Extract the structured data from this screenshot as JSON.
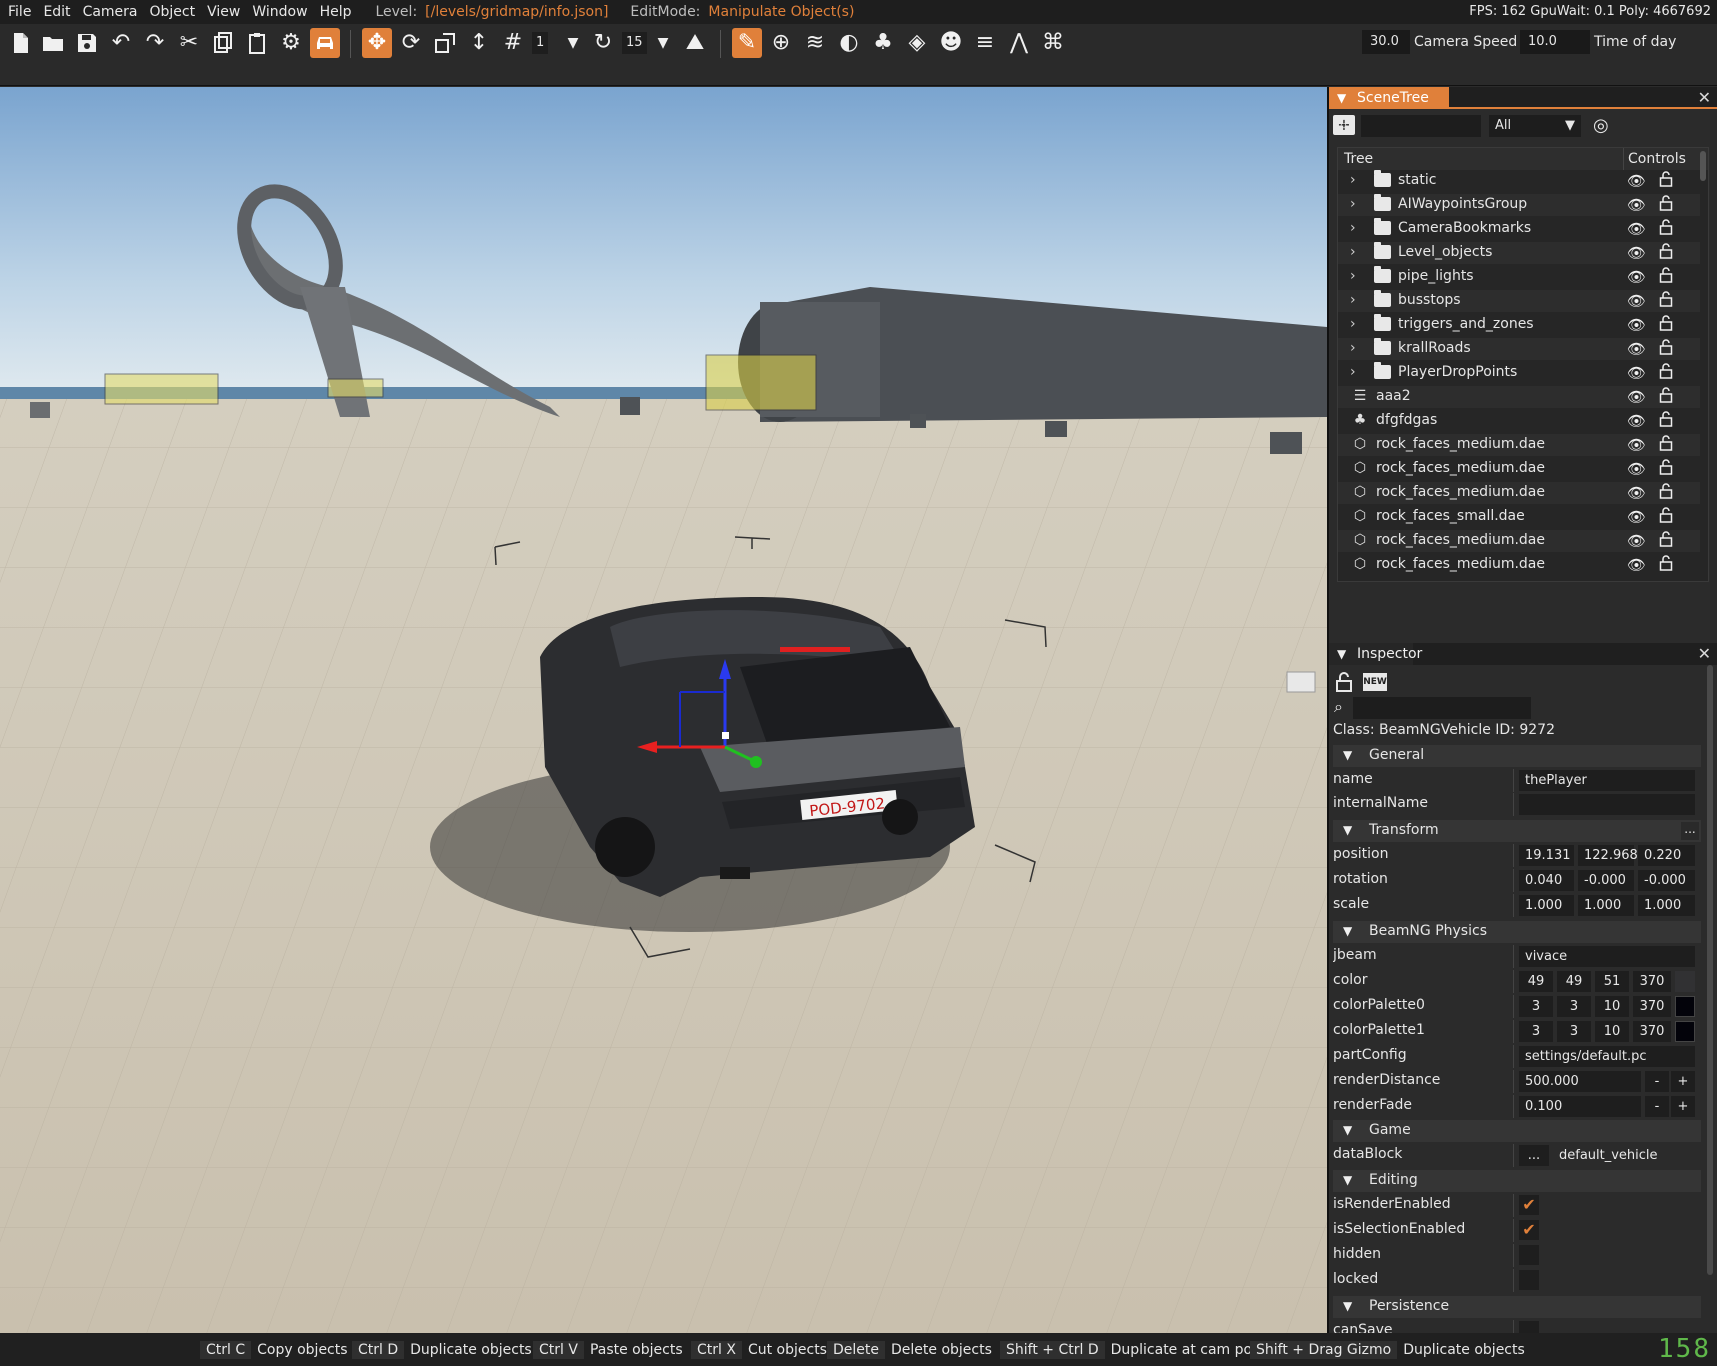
{
  "menu": {
    "items": [
      "File",
      "Edit",
      "Camera",
      "Object",
      "View",
      "Window",
      "Help"
    ],
    "level_label": "Level:",
    "level_value": "[/levels/gridmap/info.json]",
    "editmode_label": "EditMode:",
    "editmode_value": "Manipulate Object(s)",
    "stats": "FPS: 162  GpuWait: 0.1  Poly: 4667692"
  },
  "toolbar": {
    "grid_step": "1",
    "rotate_step": "15",
    "camera_speed_value": "30.0",
    "camera_speed_label": "Camera Speed",
    "time_of_day_value": "10.0",
    "time_of_day_label": "Time of day"
  },
  "scenetree": {
    "title": "SceneTree",
    "filter": "All",
    "col_tree": "Tree",
    "col_controls": "Controls",
    "items": [
      {
        "name": "static",
        "type": "folder"
      },
      {
        "name": "AIWaypointsGroup",
        "type": "folder"
      },
      {
        "name": "CameraBookmarks",
        "type": "folder"
      },
      {
        "name": "Level_objects",
        "type": "folder"
      },
      {
        "name": "pipe_lights",
        "type": "folder"
      },
      {
        "name": "busstops",
        "type": "folder"
      },
      {
        "name": "triggers_and_zones",
        "type": "folder"
      },
      {
        "name": "krallRoads",
        "type": "folder"
      },
      {
        "name": "PlayerDropPoints",
        "type": "folder"
      },
      {
        "name": "aaa2",
        "type": "road"
      },
      {
        "name": "dfgfdgas",
        "type": "forest"
      },
      {
        "name": "rock_faces_medium.dae",
        "type": "mesh"
      },
      {
        "name": "rock_faces_medium.dae",
        "type": "mesh"
      },
      {
        "name": "rock_faces_medium.dae",
        "type": "mesh"
      },
      {
        "name": "rock_faces_small.dae",
        "type": "mesh"
      },
      {
        "name": "rock_faces_medium.dae",
        "type": "mesh"
      },
      {
        "name": "rock_faces_medium.dae",
        "type": "mesh"
      }
    ]
  },
  "inspector": {
    "title": "Inspector",
    "new_label": "NEW",
    "class_line": "Class:  BeamNGVehicle     ID:  9272",
    "general": {
      "title": "General",
      "name_key": "name",
      "name_val": "thePlayer",
      "internal_key": "internalName",
      "internal_val": ""
    },
    "transform": {
      "title": "Transform",
      "position_key": "position",
      "position": [
        "19.131",
        "122.968",
        "0.220"
      ],
      "rotation_key": "rotation",
      "rotation": [
        "0.040",
        "-0.000",
        "-0.000"
      ],
      "scale_key": "scale",
      "scale": [
        "1.000",
        "1.000",
        "1.000"
      ]
    },
    "physics": {
      "title": "BeamNG Physics",
      "jbeam_key": "jbeam",
      "jbeam_val": "vivace",
      "color_key": "color",
      "color": [
        "49",
        "49",
        "51",
        "370"
      ],
      "color_swatch": "#313133",
      "pal0_key": "colorPalette0",
      "pal0": [
        "3",
        "3",
        "10",
        "370"
      ],
      "pal0_swatch": "#03030a",
      "pal1_key": "colorPalette1",
      "pal1": [
        "3",
        "3",
        "10",
        "370"
      ],
      "pal1_swatch": "#03030a",
      "partconfig_key": "partConfig",
      "partconfig_val": "settings/default.pc",
      "renderdist_key": "renderDistance",
      "renderdist_val": "500.000",
      "renderfade_key": "renderFade",
      "renderfade_val": "0.100",
      "minus": "-",
      "plus": "+"
    },
    "game": {
      "title": "Game",
      "datablock_key": "dataBlock",
      "datablock_btn": "...",
      "datablock_val": "default_vehicle"
    },
    "editing": {
      "title": "Editing",
      "render_key": "isRenderEnabled",
      "select_key": "isSelectionEnabled",
      "hidden_key": "hidden",
      "locked_key": "locked",
      "check": "✔"
    },
    "persistence": {
      "title": "Persistence",
      "cansave_key": "canSave"
    },
    "dots": "..."
  },
  "vehicle": {
    "plate": "POD-9702"
  },
  "statusbar": {
    "hints": [
      {
        "key": "Ctrl C",
        "desc": "Copy objects"
      },
      {
        "key": "Ctrl D",
        "desc": "Duplicate objects"
      },
      {
        "key": "Ctrl V",
        "desc": "Paste objects"
      },
      {
        "key": "Ctrl X",
        "desc": "Cut objects"
      },
      {
        "key": "Delete",
        "desc": "Delete objects"
      },
      {
        "key": "Shift + Ctrl D",
        "desc": "Duplicate at cam pos"
      },
      {
        "key": "Shift + Drag Gizmo",
        "desc": "Duplicate objects"
      }
    ],
    "fps": "158"
  },
  "colors": {
    "accent": "#e0803a",
    "panel": "#2b2b2b",
    "fps_green": "#5fb84a"
  }
}
